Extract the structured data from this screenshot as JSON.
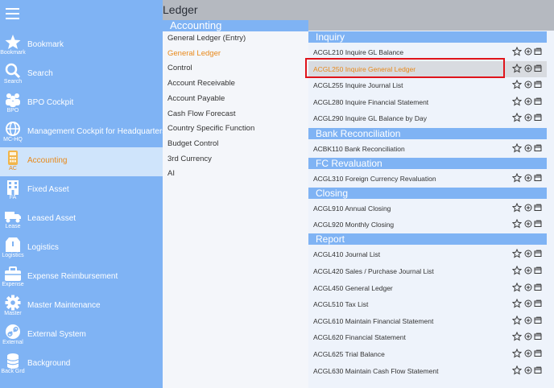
{
  "page": {
    "title": "Ledger"
  },
  "sidebar": {
    "items": [
      {
        "label": "Bookmark",
        "abbr": "Bookmark",
        "icon": "star-icon"
      },
      {
        "label": "Search",
        "abbr": "Search",
        "icon": "search-icon"
      },
      {
        "label": "BPO Cockpit",
        "abbr": "BPO",
        "icon": "people-icon"
      },
      {
        "label": "Management Cockpit for Headquarters",
        "abbr": "MC-HQ",
        "icon": "globe-icon"
      },
      {
        "label": "Accounting",
        "abbr": "AC",
        "icon": "calculator-icon",
        "active": true
      },
      {
        "label": "Fixed Asset",
        "abbr": "FA",
        "icon": "building-icon"
      },
      {
        "label": "Leased Asset",
        "abbr": "Lease",
        "icon": "truck-icon"
      },
      {
        "label": "Logistics",
        "abbr": "Logistics",
        "icon": "box-icon"
      },
      {
        "label": "Expense Reimbursement",
        "abbr": "Expense",
        "icon": "briefcase-icon"
      },
      {
        "label": "Master Maintenance",
        "abbr": "Master",
        "icon": "gear-icon"
      },
      {
        "label": "External System",
        "abbr": "External",
        "icon": "link-icon"
      },
      {
        "label": "Background",
        "abbr": "Back Grd",
        "icon": "database-icon"
      }
    ]
  },
  "subnav": {
    "header": "Accounting",
    "items": [
      {
        "label": "General Ledger (Entry)"
      },
      {
        "label": "General Ledger",
        "active": true
      },
      {
        "label": "Control"
      },
      {
        "label": "Account Receivable"
      },
      {
        "label": "Account Payable"
      },
      {
        "label": "Cash Flow Forecast"
      },
      {
        "label": "Country Specific Function"
      },
      {
        "label": "Budget Control"
      },
      {
        "label": "3rd Currency"
      },
      {
        "label": "AI"
      }
    ]
  },
  "sections": [
    {
      "title": "Inquiry",
      "rows": [
        {
          "label": "ACGL210 Inquire GL Balance"
        },
        {
          "label": "ACGL250 Inquire General Ledger",
          "selected": true
        },
        {
          "label": "ACGL255 Inquire Journal List"
        },
        {
          "label": "ACGL280 Inquire Financial Statement"
        },
        {
          "label": "ACGL290 Inquire GL Balance by Day"
        }
      ]
    },
    {
      "title": "Bank Reconciliation",
      "rows": [
        {
          "label": "ACBK110 Bank Reconciliation"
        }
      ]
    },
    {
      "title": "FC Revaluation",
      "rows": [
        {
          "label": "ACGL310 Foreign Currency Revaluation"
        }
      ]
    },
    {
      "title": "Closing",
      "rows": [
        {
          "label": "ACGL910 Annual Closing"
        },
        {
          "label": "ACGL920 Monthly Closing"
        }
      ]
    },
    {
      "title": "Report",
      "rows": [
        {
          "label": "ACGL410 Journal List"
        },
        {
          "label": "ACGL420 Sales / Purchase Journal List"
        },
        {
          "label": "ACGL450 General Ledger"
        },
        {
          "label": "ACGL510 Tax List"
        },
        {
          "label": "ACGL610 Maintain Financial Statement"
        },
        {
          "label": "ACGL620 Financial Statement"
        },
        {
          "label": "ACGL625 Trial Balance"
        },
        {
          "label": "ACGL630 Maintain Cash Flow Statement"
        }
      ]
    }
  ],
  "colors": {
    "sidebar": "#7fb3f4",
    "active": "#e8891a",
    "highlight": "#e0141b",
    "active_bg": "#cfe4fb"
  }
}
